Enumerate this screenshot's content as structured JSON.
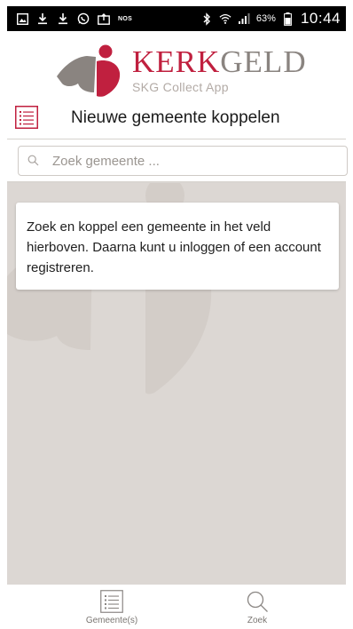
{
  "status_bar": {
    "carrier_badge": "NOS",
    "battery_percent": "63%",
    "time": "10:44",
    "icons": [
      "image-icon",
      "download-icon",
      "download-icon",
      "whatsapp-icon",
      "photo-upload-icon",
      "bluetooth-icon",
      "wifi-icon",
      "signal-icon",
      "battery-icon"
    ]
  },
  "logo": {
    "brand_part1": "KERK",
    "brand_part2": "GELD",
    "subtitle": "SKG Collect App"
  },
  "header": {
    "title": "Nieuwe gemeente koppelen"
  },
  "search": {
    "placeholder": "Zoek gemeente ..."
  },
  "info_card": {
    "text": "Zoek en koppel een gemeente in het veld hierboven. Daarna kunt u inloggen of een account registreren."
  },
  "bottom_nav": {
    "items": [
      {
        "label": "Gemeente(s)",
        "icon": "list-icon"
      },
      {
        "label": "Zoek",
        "icon": "search-icon"
      }
    ]
  },
  "colors": {
    "brand_red": "#c0203f",
    "brand_gray": "#8a8480",
    "content_bg": "#dcd7d3"
  }
}
